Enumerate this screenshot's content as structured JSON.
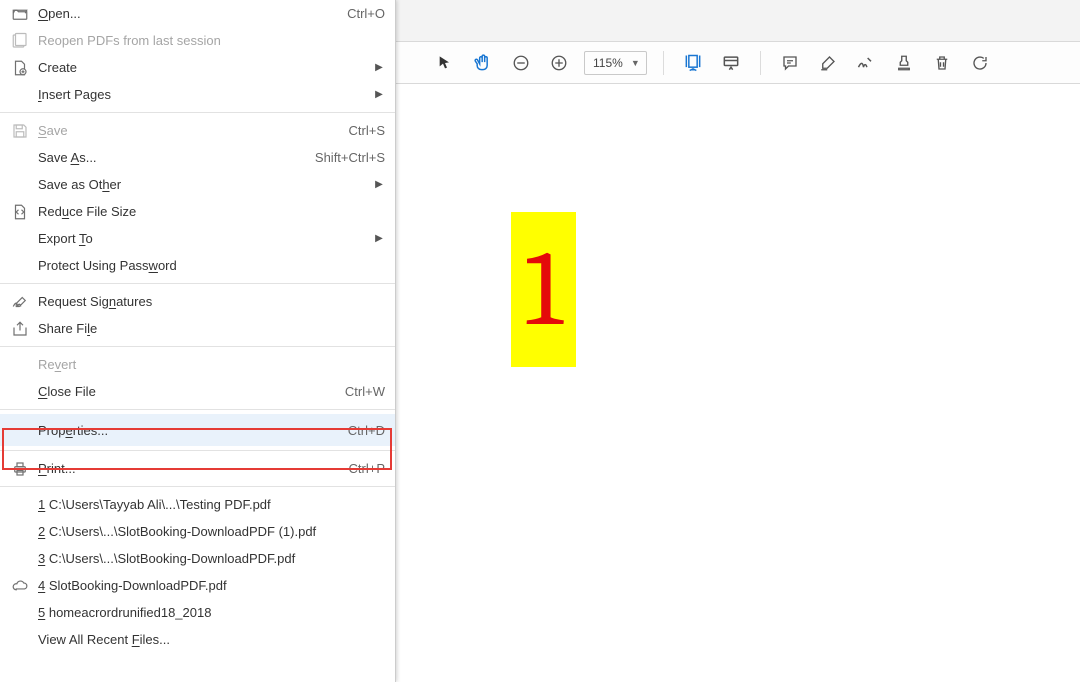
{
  "menu": {
    "open": {
      "label": "Open...",
      "shortcut": "Ctrl+O"
    },
    "reopen": {
      "label": "Reopen PDFs from last session"
    },
    "create": {
      "label": "Create"
    },
    "insert": {
      "label": "Insert Pages"
    },
    "save": {
      "label": "Save",
      "shortcut": "Ctrl+S"
    },
    "saveas": {
      "label": "Save As...",
      "shortcut": "Shift+Ctrl+S"
    },
    "saveother": {
      "label": "Save as Other"
    },
    "reduce": {
      "label": "Reduce File Size"
    },
    "export": {
      "label": "Export To"
    },
    "protect": {
      "label": "Protect Using Password"
    },
    "sign": {
      "label": "Request Signatures"
    },
    "share": {
      "label": "Share File"
    },
    "revert": {
      "label": "Revert"
    },
    "close": {
      "label": "Close File",
      "shortcut": "Ctrl+W"
    },
    "properties": {
      "label": "Properties...",
      "shortcut": "Ctrl+D"
    },
    "print": {
      "label": "Print...",
      "shortcut": "Ctrl+P"
    },
    "recent1": {
      "label": "1 C:\\Users\\Tayyab Ali\\...\\Testing PDF.pdf"
    },
    "recent2": {
      "label": "2 C:\\Users\\...\\SlotBooking-DownloadPDF (1).pdf"
    },
    "recent3": {
      "label": "3 C:\\Users\\...\\SlotBooking-DownloadPDF.pdf"
    },
    "recent4": {
      "label": "4 SlotBooking-DownloadPDF.pdf"
    },
    "recent5": {
      "label": "5 homeacrordrunified18_2018"
    },
    "viewall": {
      "label": "View All Recent Files..."
    }
  },
  "toolbar": {
    "zoom": "115%"
  },
  "page": {
    "stampText": "1"
  }
}
